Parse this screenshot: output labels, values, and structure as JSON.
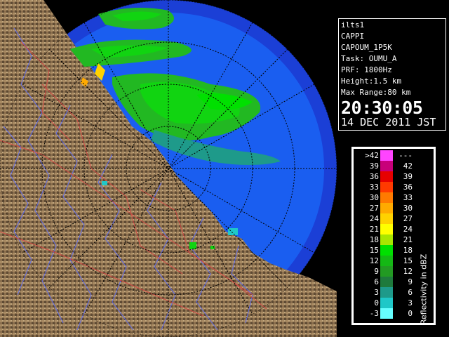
{
  "info": {
    "site": "ilts1",
    "product": "CAPPI",
    "product_name": "CAPOUM_1P5K",
    "task": "Task: OUMU_A",
    "prf": "PRF: 1800Hz",
    "height": "Height:1.5 km",
    "max_range": "Max Range:80 km",
    "time": "20:30:05",
    "date": "14 DEC 2011 JST"
  },
  "legend": {
    "title": "Reflectivity in dBZ",
    "rows": [
      {
        "lo": ">42",
        "hi": "---",
        "color": "#ff44ff"
      },
      {
        "lo": "39",
        "hi": "42",
        "color": "#c8007a"
      },
      {
        "lo": "36",
        "hi": "39",
        "color": "#e60000"
      },
      {
        "lo": "33",
        "hi": "36",
        "color": "#ff3a00"
      },
      {
        "lo": "30",
        "hi": "33",
        "color": "#ff7a00"
      },
      {
        "lo": "27",
        "hi": "30",
        "color": "#ffaa00"
      },
      {
        "lo": "24",
        "hi": "27",
        "color": "#ffd200"
      },
      {
        "lo": "21",
        "hi": "24",
        "color": "#ffff00"
      },
      {
        "lo": "18",
        "hi": "21",
        "color": "#a8e600"
      },
      {
        "lo": "15",
        "hi": "18",
        "color": "#00e000"
      },
      {
        "lo": "12",
        "hi": "15",
        "color": "#14b814"
      },
      {
        "lo": "9",
        "hi": "12",
        "color": "#229a22"
      },
      {
        "lo": "6",
        "hi": "9",
        "color": "#1e7a3c"
      },
      {
        "lo": "3",
        "hi": "6",
        "color": "#1e9a8a"
      },
      {
        "lo": "0",
        "hi": "3",
        "color": "#1fc8c8"
      },
      {
        "lo": "-3",
        "hi": "0",
        "color": "#66ffff"
      }
    ]
  },
  "map": {
    "colors": {
      "background": "#000000",
      "sea": "#1a5ef0",
      "deep_sea": "#1b3fd6",
      "land": "#8b6f4e",
      "land_light": "#b39a72",
      "land_dark": "#4a3a28",
      "rivers": "#5a6cff",
      "boundaries": "#d44",
      "range_rings": "#000000"
    }
  }
}
